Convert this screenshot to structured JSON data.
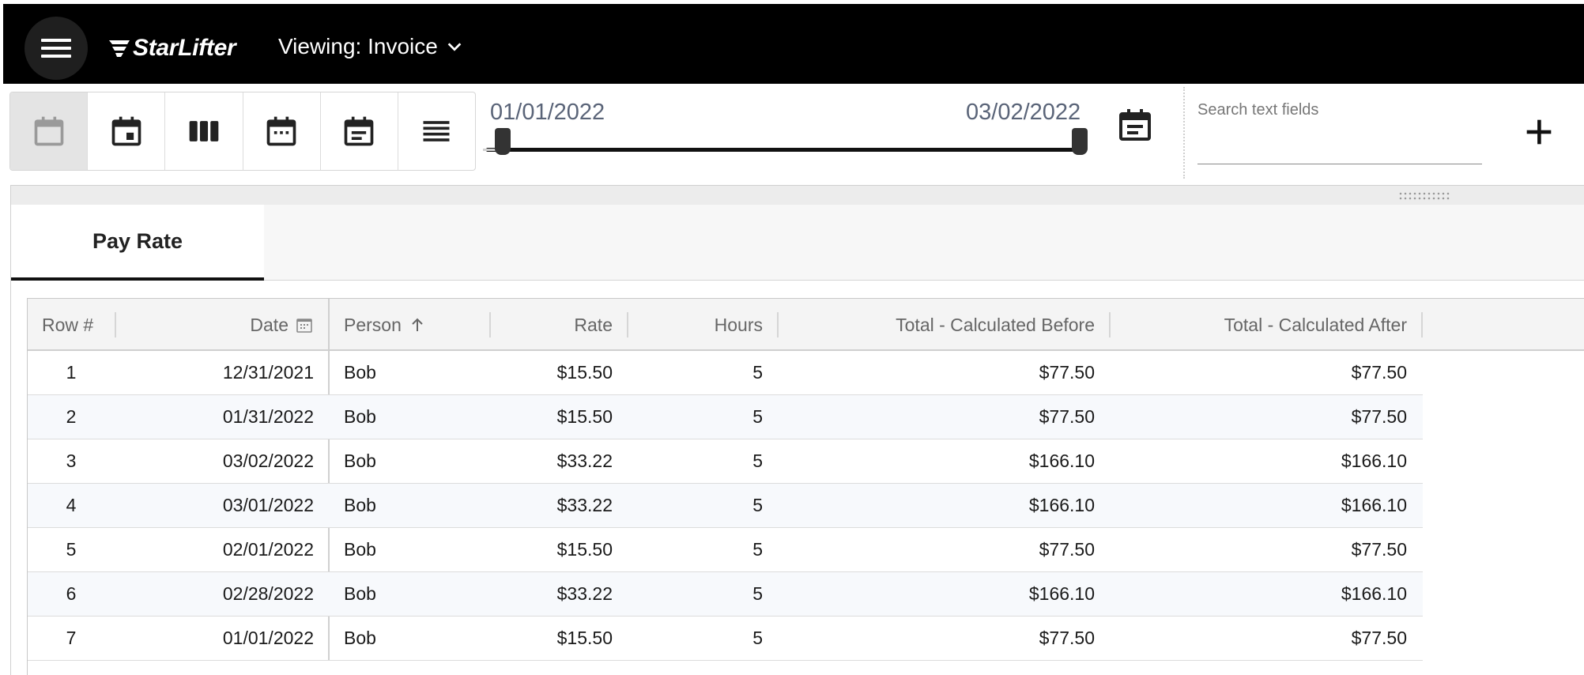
{
  "header": {
    "logo_text": "StarLifter",
    "viewing_label": "Viewing: Invoice"
  },
  "toolbar": {
    "view_buttons": [
      {
        "name": "calendar-blank-icon"
      },
      {
        "name": "calendar-day-icon"
      },
      {
        "name": "columns-icon"
      },
      {
        "name": "calendar-month-icon"
      },
      {
        "name": "calendar-agenda-icon"
      },
      {
        "name": "list-icon"
      }
    ],
    "date_start": "01/01/2022",
    "date_end": "03/02/2022",
    "search_placeholder": "Search text fields",
    "search_value": ""
  },
  "tabs": [
    {
      "label": "Pay Rate",
      "active": true
    }
  ],
  "table": {
    "columns": [
      "Row #",
      "Date",
      "Person",
      "Rate",
      "Hours",
      "Total - Calculated Before",
      "Total - Calculated After"
    ],
    "rows": [
      [
        "1",
        "12/31/2021",
        "Bob",
        "$15.50",
        "5",
        "$77.50",
        "$77.50"
      ],
      [
        "2",
        "01/31/2022",
        "Bob",
        "$15.50",
        "5",
        "$77.50",
        "$77.50"
      ],
      [
        "3",
        "03/02/2022",
        "Bob",
        "$33.22",
        "5",
        "$166.10",
        "$166.10"
      ],
      [
        "4",
        "03/01/2022",
        "Bob",
        "$33.22",
        "5",
        "$166.10",
        "$166.10"
      ],
      [
        "5",
        "02/01/2022",
        "Bob",
        "$15.50",
        "5",
        "$77.50",
        "$77.50"
      ],
      [
        "6",
        "02/28/2022",
        "Bob",
        "$33.22",
        "5",
        "$166.10",
        "$166.10"
      ],
      [
        "7",
        "01/01/2022",
        "Bob",
        "$15.50",
        "5",
        "$77.50",
        "$77.50"
      ]
    ]
  },
  "colors": {
    "header_bg": "#000000",
    "date_text": "#5a6478",
    "alt_row": "#f7f9fc"
  }
}
